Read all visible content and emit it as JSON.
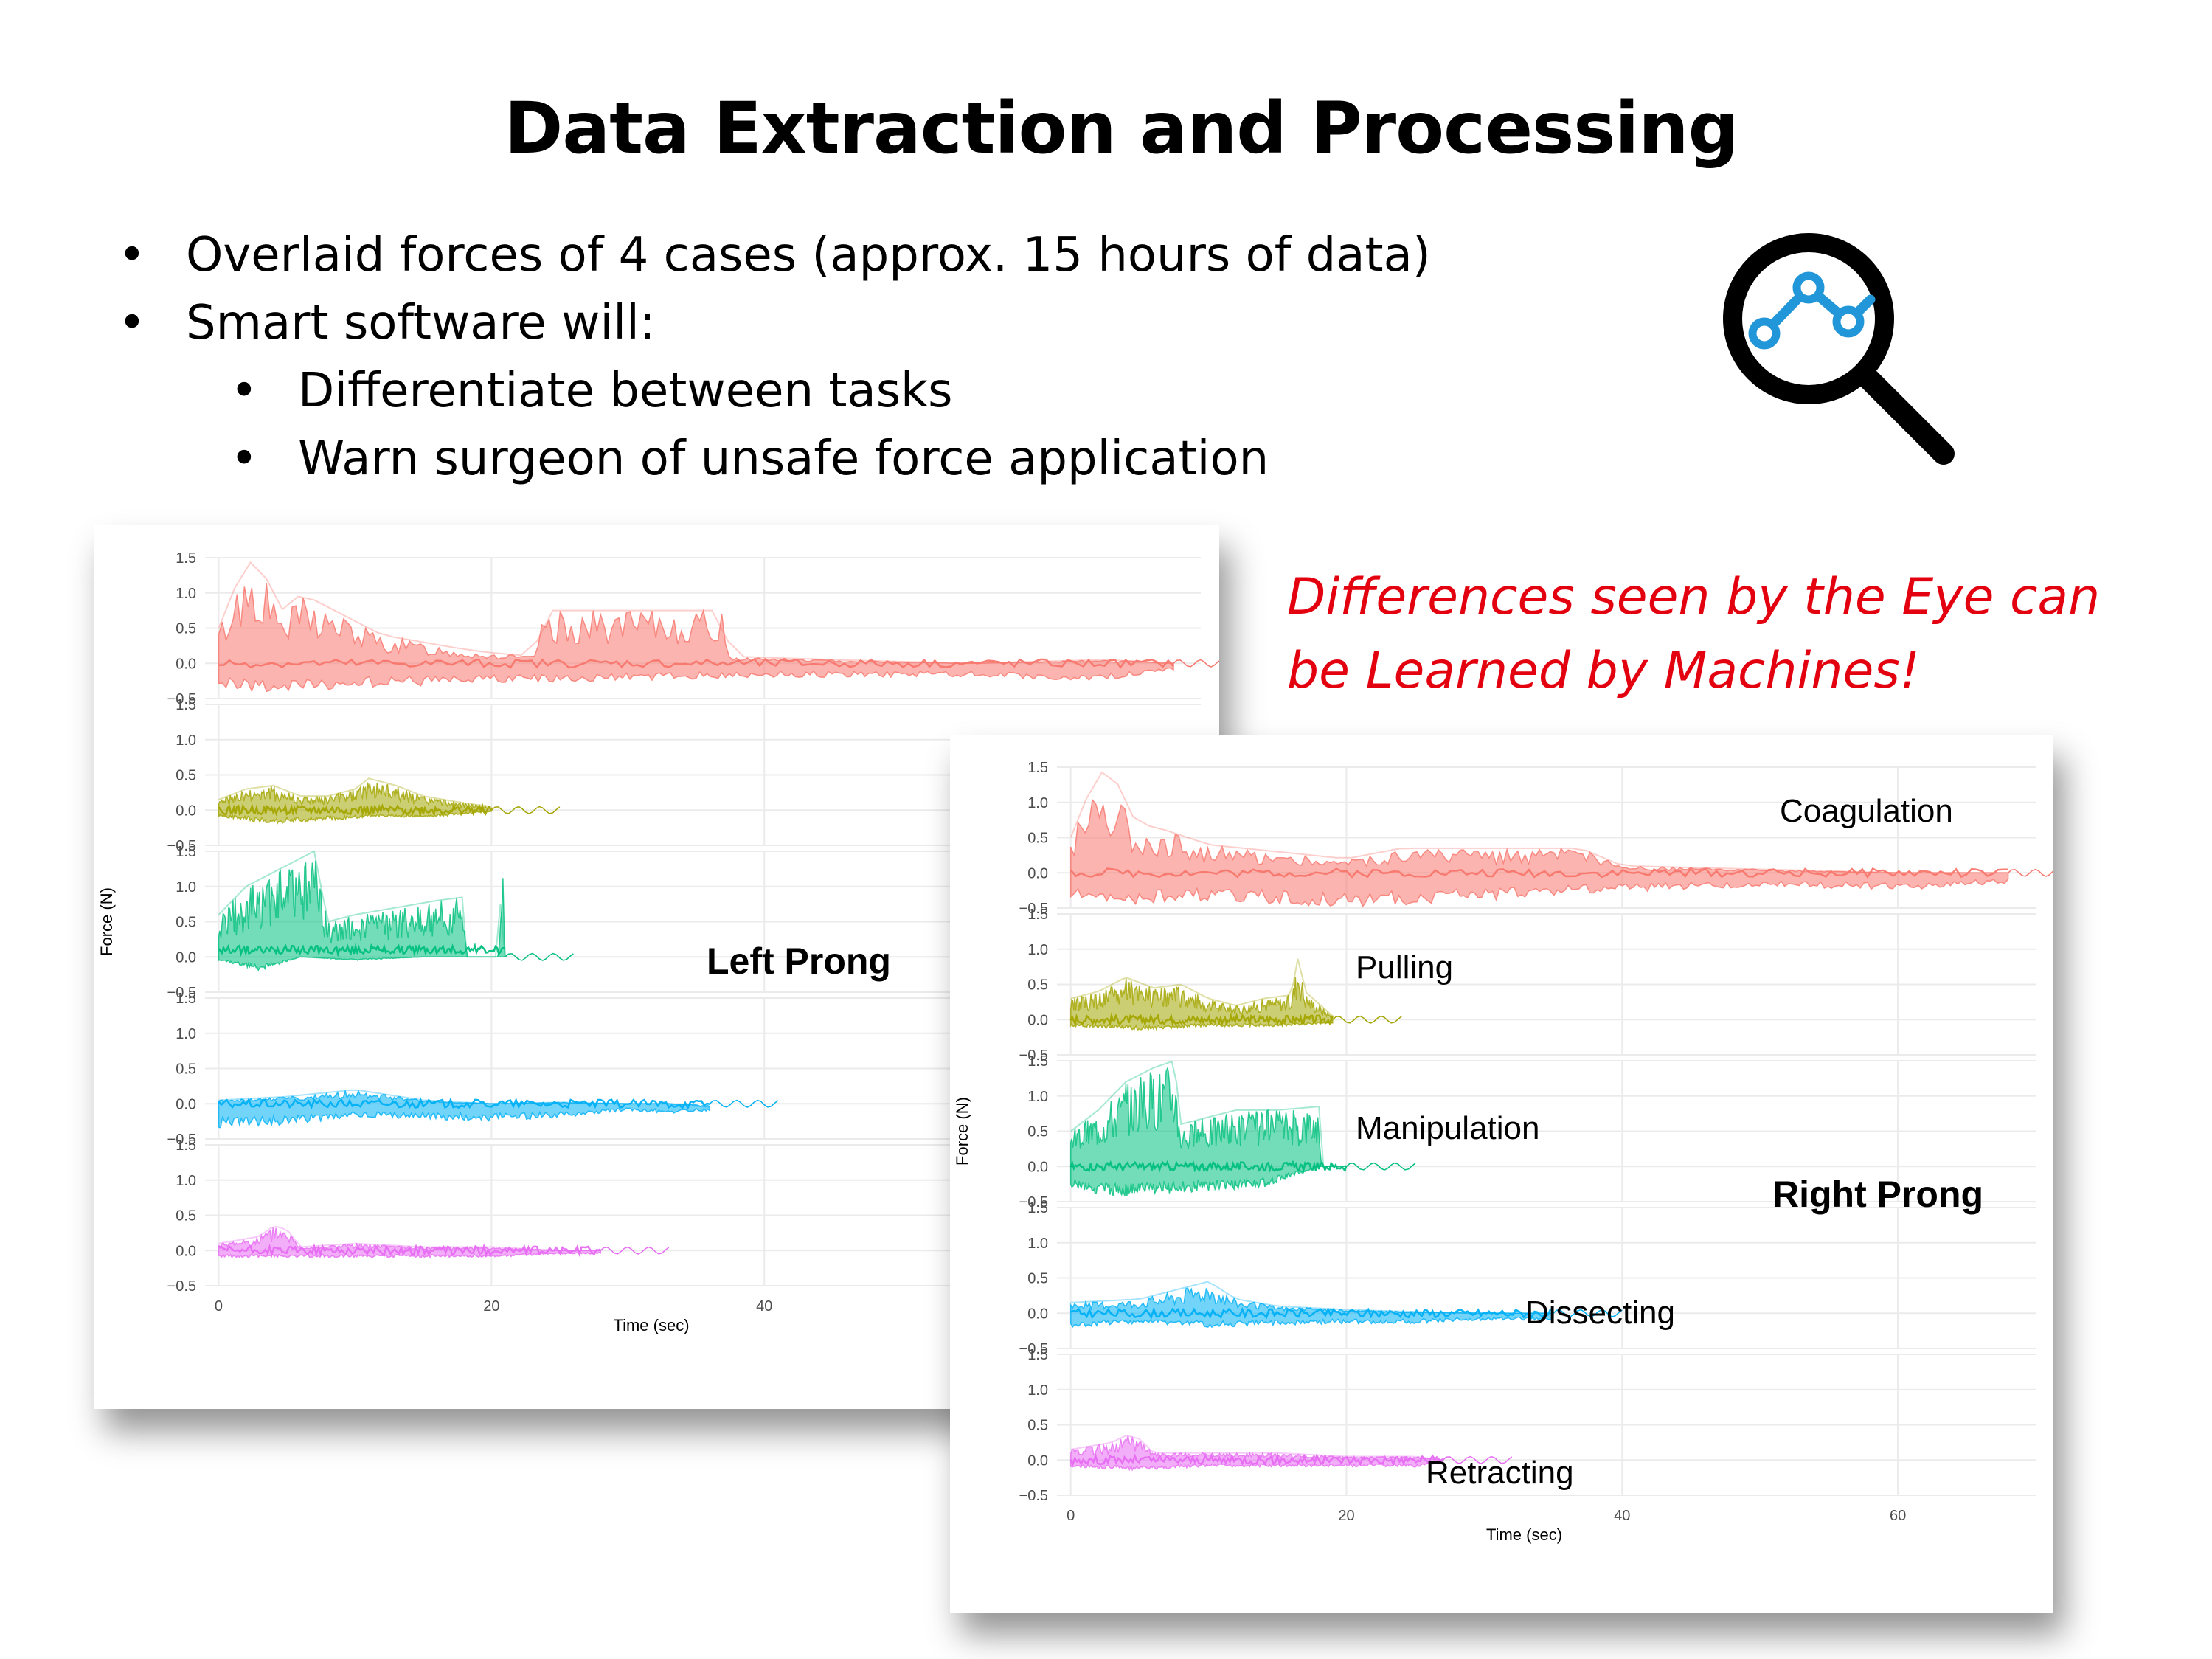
{
  "slide": {
    "title": "Data Extraction and Processing",
    "bullets": [
      "Overlaid forces of 4 cases (approx. 15 hours of data)",
      "Smart software will:"
    ],
    "sub_bullets": [
      "Differentiate between tasks",
      "Warn surgeon of unsafe force application"
    ],
    "quote_lines": [
      "Differences seen by the Eye can",
      "be Learned by Machines!"
    ],
    "icon": "magnifier-chart-icon",
    "colors": {
      "quote": "#e3000f",
      "icon_accent": "#2196d9"
    }
  },
  "chart_data": [
    {
      "type": "area",
      "label": "Left Prong",
      "xlabel": "Time (sec)",
      "ylabel": "Force (N)",
      "xlim": [
        -1,
        72
      ],
      "x_ticks": [
        "0",
        "20",
        "40"
      ],
      "x_tick_values": [
        0,
        20,
        40
      ],
      "ylim": [
        -0.5,
        1.5
      ],
      "y_ticks": [
        "−0.5",
        "0.0",
        "0.5",
        "1.0",
        "1.5"
      ],
      "grid": true,
      "panel_labels": [
        "",
        "",
        "",
        "",
        ""
      ],
      "series": [
        {
          "color": "#f8766d",
          "end": 70,
          "base": 0.0,
          "upper": [
            [
              0,
              0.5
            ],
            [
              1,
              1.0
            ],
            [
              2,
              1.4
            ],
            [
              3,
              1.5
            ],
            [
              4,
              0.9
            ],
            [
              5,
              0.7
            ],
            [
              6,
              1.0
            ],
            [
              8,
              0.8
            ],
            [
              10,
              0.6
            ],
            [
              12,
              0.4
            ],
            [
              15,
              0.3
            ],
            [
              18,
              0.2
            ],
            [
              20,
              0.15
            ],
            [
              23,
              0.1
            ],
            [
              24,
              0.75
            ],
            [
              37,
              0.75
            ],
            [
              37.5,
              0.1
            ],
            [
              45,
              0.05
            ],
            [
              55,
              0.0
            ],
            [
              65,
              0.05
            ],
            [
              70,
              0.0
            ]
          ],
          "lower": [
            [
              0,
              -0.35
            ],
            [
              5,
              -0.45
            ],
            [
              10,
              -0.35
            ],
            [
              20,
              -0.3
            ],
            [
              30,
              -0.25
            ],
            [
              40,
              -0.2
            ],
            [
              55,
              -0.2
            ],
            [
              65,
              -0.25
            ],
            [
              70,
              -0.1
            ]
          ]
        },
        {
          "color": "#a3a500",
          "end": 20,
          "base": 0.0,
          "upper": [
            [
              0,
              0.15
            ],
            [
              2,
              0.3
            ],
            [
              4,
              0.35
            ],
            [
              6,
              0.2
            ],
            [
              8,
              0.2
            ],
            [
              10,
              0.3
            ],
            [
              11,
              0.45
            ],
            [
              13,
              0.35
            ],
            [
              15,
              0.2
            ],
            [
              18,
              0.1
            ],
            [
              20,
              0.05
            ]
          ],
          "lower": [
            [
              0,
              -0.1
            ],
            [
              4,
              -0.2
            ],
            [
              8,
              -0.15
            ],
            [
              12,
              -0.1
            ],
            [
              16,
              -0.1
            ],
            [
              20,
              -0.02
            ]
          ]
        },
        {
          "color": "#00bf7d",
          "end": 21,
          "base": 0.1,
          "upper": [
            [
              0,
              0.6
            ],
            [
              2,
              1.0
            ],
            [
              4,
              1.2
            ],
            [
              6,
              1.4
            ],
            [
              7,
              1.5
            ],
            [
              8,
              0.5
            ],
            [
              10,
              0.6
            ],
            [
              13,
              0.7
            ],
            [
              16,
              0.8
            ],
            [
              18,
              0.85
            ],
            [
              18.2,
              0.0
            ],
            [
              20.5,
              0.0
            ],
            [
              20.8,
              1.5
            ],
            [
              21,
              0.0
            ]
          ],
          "lower": [
            [
              0,
              -0.05
            ],
            [
              3,
              -0.2
            ],
            [
              6,
              0.0
            ],
            [
              10,
              -0.05
            ],
            [
              15,
              0.0
            ],
            [
              18,
              0.0
            ]
          ]
        },
        {
          "color": "#00b0f6",
          "end": 36,
          "base": 0.0,
          "upper": [
            [
              0,
              0.05
            ],
            [
              5,
              0.1
            ],
            [
              10,
              0.2
            ],
            [
              15,
              0.05
            ],
            [
              20,
              0.0
            ],
            [
              25,
              0.02
            ],
            [
              30,
              0.0
            ],
            [
              33,
              0.0
            ],
            [
              36,
              -0.05
            ]
          ],
          "lower": [
            [
              0,
              -0.35
            ],
            [
              5,
              -0.3
            ],
            [
              10,
              -0.2
            ],
            [
              20,
              -0.25
            ],
            [
              25,
              -0.2
            ],
            [
              30,
              -0.1
            ],
            [
              33,
              -0.15
            ],
            [
              36,
              -0.1
            ]
          ]
        },
        {
          "color": "#e76bf3",
          "end": 28,
          "base": 0.0,
          "upper": [
            [
              0,
              0.1
            ],
            [
              3,
              0.2
            ],
            [
              4,
              0.35
            ],
            [
              5,
              0.3
            ],
            [
              6,
              0.05
            ],
            [
              10,
              0.1
            ],
            [
              15,
              0.05
            ],
            [
              20,
              0.05
            ],
            [
              25,
              0.0
            ],
            [
              28,
              0.0
            ]
          ],
          "lower": [
            [
              0,
              -0.1
            ],
            [
              5,
              -0.1
            ],
            [
              10,
              -0.1
            ],
            [
              20,
              -0.1
            ],
            [
              25,
              -0.05
            ],
            [
              28,
              -0.05
            ]
          ]
        }
      ]
    },
    {
      "type": "area",
      "label": "Right Prong",
      "xlabel": "Time (sec)",
      "ylabel": "Force (N)",
      "xlim": [
        -1,
        70
      ],
      "x_ticks": [
        "0",
        "20",
        "40",
        "60"
      ],
      "x_tick_values": [
        0,
        20,
        40,
        60
      ],
      "ylim": [
        -0.5,
        1.5
      ],
      "y_ticks": [
        "−0.5",
        "0.0",
        "0.5",
        "1.0",
        "1.5"
      ],
      "grid": true,
      "panel_labels": [
        "Coagulation",
        "Pulling",
        "Manipulation",
        "Dissecting",
        "Retracting"
      ],
      "series": [
        {
          "color": "#f8766d",
          "end": 68,
          "base": 0.0,
          "upper": [
            [
              0,
              0.5
            ],
            [
              1,
              1.0
            ],
            [
              2,
              1.4
            ],
            [
              3,
              1.5
            ],
            [
              4,
              0.9
            ],
            [
              5,
              0.7
            ],
            [
              7,
              0.6
            ],
            [
              10,
              0.4
            ],
            [
              15,
              0.3
            ],
            [
              20,
              0.2
            ],
            [
              24,
              0.35
            ],
            [
              37,
              0.35
            ],
            [
              40,
              0.1
            ],
            [
              50,
              0.05
            ],
            [
              60,
              0.0
            ],
            [
              68,
              0.0
            ]
          ],
          "lower": [
            [
              0,
              -0.4
            ],
            [
              5,
              -0.45
            ],
            [
              10,
              -0.4
            ],
            [
              20,
              -0.5
            ],
            [
              30,
              -0.4
            ],
            [
              38,
              -0.3
            ],
            [
              50,
              -0.2
            ],
            [
              60,
              -0.25
            ],
            [
              68,
              -0.15
            ]
          ]
        },
        {
          "color": "#a3a500",
          "end": 19,
          "base": 0.0,
          "upper": [
            [
              0,
              0.3
            ],
            [
              2,
              0.4
            ],
            [
              4,
              0.6
            ],
            [
              6,
              0.45
            ],
            [
              8,
              0.5
            ],
            [
              10,
              0.3
            ],
            [
              12,
              0.2
            ],
            [
              14,
              0.3
            ],
            [
              16,
              0.35
            ],
            [
              16.5,
              0.9
            ],
            [
              17,
              0.4
            ],
            [
              19,
              0.05
            ]
          ],
          "lower": [
            [
              0,
              -0.1
            ],
            [
              5,
              -0.15
            ],
            [
              10,
              -0.1
            ],
            [
              15,
              -0.1
            ],
            [
              19,
              -0.05
            ]
          ]
        },
        {
          "color": "#00bf7d",
          "end": 20,
          "base": 0.0,
          "upper": [
            [
              0,
              0.5
            ],
            [
              2,
              0.8
            ],
            [
              4,
              1.2
            ],
            [
              6,
              1.4
            ],
            [
              7.5,
              1.5
            ],
            [
              8,
              0.6
            ],
            [
              10,
              0.7
            ],
            [
              12,
              0.8
            ],
            [
              15,
              0.8
            ],
            [
              18,
              0.85
            ],
            [
              18.2,
              0.0
            ],
            [
              20,
              0.0
            ]
          ],
          "lower": [
            [
              0,
              -0.3
            ],
            [
              3,
              -0.45
            ],
            [
              6,
              -0.4
            ],
            [
              10,
              -0.35
            ],
            [
              14,
              -0.3
            ],
            [
              18,
              0.0
            ]
          ]
        },
        {
          "color": "#00b0f6",
          "end": 35,
          "base": 0.0,
          "upper": [
            [
              0,
              0.15
            ],
            [
              5,
              0.2
            ],
            [
              8,
              0.35
            ],
            [
              10,
              0.45
            ],
            [
              12,
              0.2
            ],
            [
              15,
              0.1
            ],
            [
              20,
              0.05
            ],
            [
              25,
              0.02
            ],
            [
              30,
              0.0
            ],
            [
              35,
              0.0
            ]
          ],
          "lower": [
            [
              0,
              -0.2
            ],
            [
              5,
              -0.15
            ],
            [
              10,
              -0.2
            ],
            [
              20,
              -0.15
            ],
            [
              25,
              -0.15
            ],
            [
              30,
              -0.1
            ],
            [
              35,
              -0.1
            ]
          ]
        },
        {
          "color": "#e76bf3",
          "end": 27,
          "base": 0.0,
          "upper": [
            [
              0,
              0.15
            ],
            [
              3,
              0.25
            ],
            [
              4,
              0.35
            ],
            [
              5,
              0.3
            ],
            [
              6,
              0.1
            ],
            [
              10,
              0.1
            ],
            [
              15,
              0.1
            ],
            [
              20,
              0.05
            ],
            [
              25,
              0.05
            ],
            [
              27,
              0.0
            ]
          ],
          "lower": [
            [
              0,
              -0.1
            ],
            [
              5,
              -0.15
            ],
            [
              10,
              -0.1
            ],
            [
              20,
              -0.1
            ],
            [
              25,
              -0.1
            ],
            [
              27,
              -0.05
            ]
          ]
        }
      ]
    }
  ]
}
